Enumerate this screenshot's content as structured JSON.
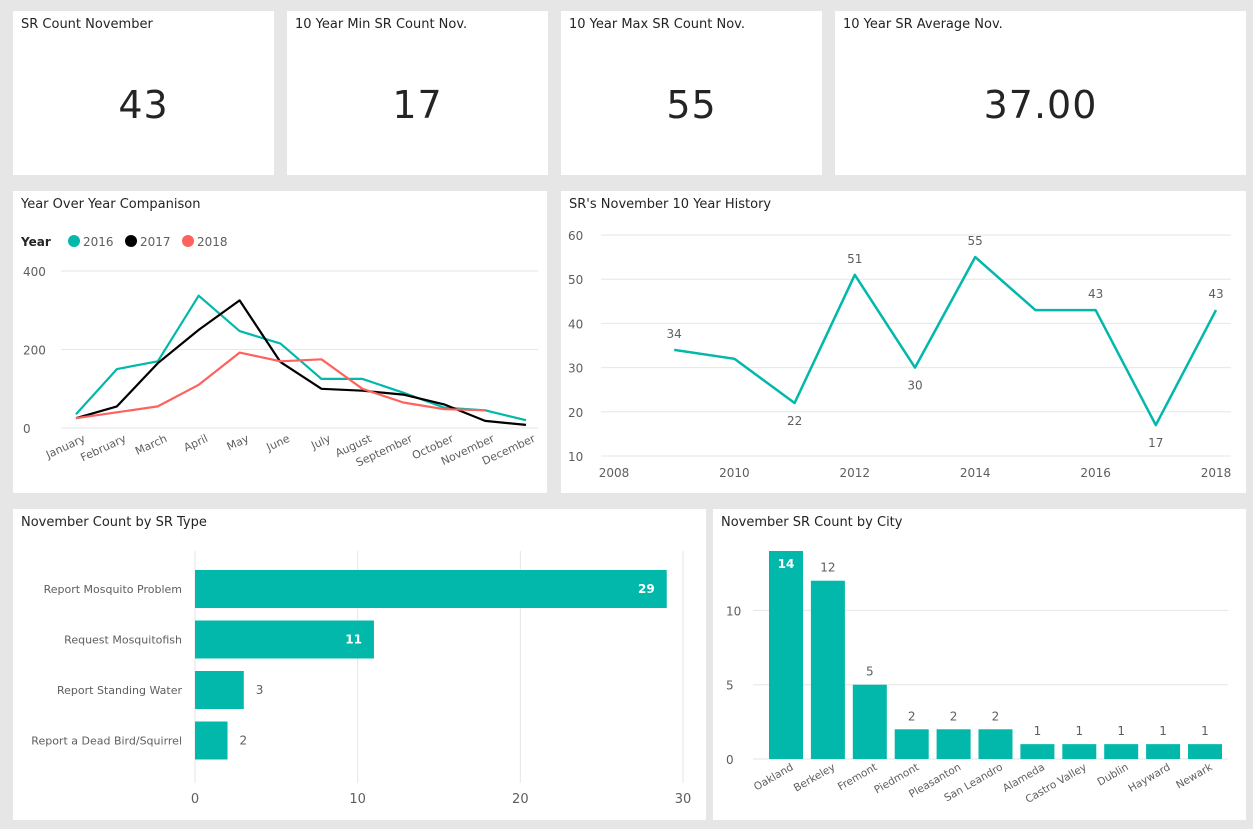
{
  "kpis": [
    {
      "title": "SR Count November",
      "value": "43"
    },
    {
      "title": "10 Year Min SR Count Nov.",
      "value": "17"
    },
    {
      "title": "10 Year Max SR Count Nov.",
      "value": "55"
    },
    {
      "title": "10 Year SR Average Nov.",
      "value": "37.00"
    }
  ],
  "colors": {
    "teal": "#01b8aa",
    "black": "#000000",
    "red": "#fd625e",
    "grid": "#e6e6e6",
    "axis_text": "#605e5c"
  },
  "chart_data": [
    {
      "id": "yoy",
      "type": "line",
      "title": "Year Over Year Companison",
      "legend_title": "Year",
      "legend_position": "top-left",
      "categories": [
        "January",
        "February",
        "March",
        "April",
        "May",
        "June",
        "July",
        "August",
        "September",
        "October",
        "November",
        "December"
      ],
      "series": [
        {
          "name": "2016",
          "color": "#01b8aa",
          "values": [
            35,
            150,
            170,
            337,
            247,
            215,
            125,
            125,
            90,
            52,
            45,
            20
          ]
        },
        {
          "name": "2017",
          "color": "#000000",
          "values": [
            25,
            55,
            165,
            250,
            325,
            168,
            100,
            95,
            85,
            60,
            18,
            8
          ]
        },
        {
          "name": "2018",
          "color": "#fd625e",
          "values": [
            25,
            40,
            55,
            110,
            192,
            170,
            175,
            100,
            65,
            48,
            45,
            null
          ]
        }
      ],
      "y_ticks": [
        0,
        200,
        400
      ],
      "ylim": [
        0,
        400
      ],
      "grid": true
    },
    {
      "id": "history",
      "type": "line",
      "title": "SR's November 10 Year History",
      "x": [
        2009,
        2010,
        2011,
        2012,
        2013,
        2014,
        2015,
        2016,
        2017,
        2018
      ],
      "values": [
        34,
        32,
        22,
        51,
        30,
        55,
        43,
        43,
        17,
        43
      ],
      "data_labels": [
        {
          "x": 2009,
          "text": "34"
        },
        {
          "x": 2011,
          "text": "22"
        },
        {
          "x": 2012,
          "text": "51"
        },
        {
          "x": 2013,
          "text": "30"
        },
        {
          "x": 2014,
          "text": "55"
        },
        {
          "x": 2016,
          "text": "43"
        },
        {
          "x": 2017,
          "text": "17"
        },
        {
          "x": 2018,
          "text": "43"
        }
      ],
      "x_ticks": [
        2008,
        2010,
        2012,
        2014,
        2016,
        2018
      ],
      "y_ticks": [
        10,
        20,
        30,
        40,
        50,
        60
      ],
      "xlim": [
        2008,
        2018
      ],
      "ylim": [
        10,
        60
      ],
      "color": "#01b8aa",
      "grid": true
    },
    {
      "id": "by_type",
      "type": "bar",
      "orientation": "horizontal",
      "title": "November Count by SR Type",
      "categories": [
        "Report Mosquito Problem",
        "Request Mosquitofish",
        "Report Standing Water",
        "Report a Dead Bird/Squirrel"
      ],
      "values": [
        29,
        11,
        3,
        2
      ],
      "x_ticks": [
        0,
        10,
        20,
        30
      ],
      "xlim": [
        0,
        30
      ],
      "color": "#01b8aa",
      "grid": true
    },
    {
      "id": "by_city",
      "type": "bar",
      "title": "November SR Count by City",
      "categories": [
        "Oakland",
        "Berkeley",
        "Fremont",
        "Piedmont",
        "Pleasanton",
        "San Leandro",
        "Alameda",
        "Castro Valley",
        "Dublin",
        "Hayward",
        "Newark"
      ],
      "values": [
        14,
        12,
        5,
        2,
        2,
        2,
        1,
        1,
        1,
        1,
        1
      ],
      "y_ticks": [
        0,
        5,
        10
      ],
      "ylim": [
        0,
        14
      ],
      "color": "#01b8aa",
      "grid": true
    }
  ]
}
